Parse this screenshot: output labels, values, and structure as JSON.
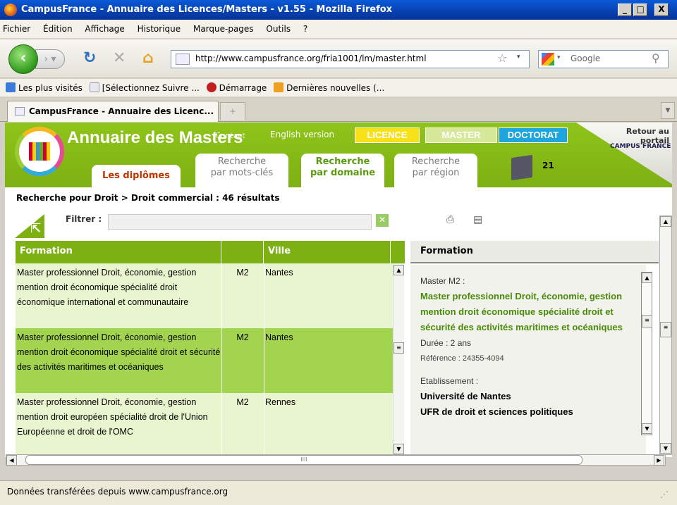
{
  "window": {
    "title": "CampusFrance - Annuaire des Licences/Masters - v1.55 - Mozilla Firefox",
    "minimize": "_",
    "maximize": "□",
    "close": "X"
  },
  "menu": [
    "Fichier",
    "Édition",
    "Affichage",
    "Historique",
    "Marque-pages",
    "Outils",
    "?"
  ],
  "nav": {
    "url": "http://www.campusfrance.org/fria1001/lm/master.html",
    "search_placeholder": "Google"
  },
  "bookmarks": [
    "Les plus visités",
    "[Sélectionnez Suivre ...",
    "Démarrage",
    "Dernières nouvelles (..."
  ],
  "tabs": {
    "active": "CampusFrance - Annuaire des Licenc...",
    "new": "+"
  },
  "site": {
    "title": "Annuaire des Masters",
    "contact": "Contact",
    "english": "English version",
    "levels": {
      "licence": "LICENCE",
      "master": "MASTER",
      "doctorat": "DOCTORAT"
    },
    "retour": "Retour au portail",
    "cf_logo": "CAMPUS FRANCE",
    "tab_diplomes": "Les diplômes",
    "tab_motscles_1": "Recherche",
    "tab_motscles_2": "par mots-clés",
    "tab_domaine_1": "Recherche",
    "tab_domaine_2": "par domaine",
    "tab_region_1": "Recherche",
    "tab_region_2": "par région",
    "selection_count": "21"
  },
  "breadcrumb": "Recherche pour Droit > Droit commercial : 46 résultats",
  "filter": {
    "label": "Filtrer :",
    "value": "",
    "clear": "✕"
  },
  "table": {
    "headers": {
      "formation": "Formation",
      "level": "",
      "ville": "Ville"
    },
    "rows": [
      {
        "formation": "Master professionnel Droit, économie, gestion mention droit économique spécialité droit économique international et communautaire",
        "level": "M2",
        "ville": "Nantes"
      },
      {
        "formation": "Master professionnel Droit, économie, gestion mention droit économique spécialité droit et sécurité des activités maritimes et océaniques",
        "level": "M2",
        "ville": "Nantes"
      },
      {
        "formation": "Master professionnel Droit, économie, gestion mention droit européen spécialité droit de l'Union Européenne et droit de l'OMC",
        "level": "M2",
        "ville": "Rennes"
      }
    ]
  },
  "detail": {
    "header": "Formation",
    "level_label": "Master M2 :",
    "title": "Master professionnel Droit, économie, gestion mention droit économique spécialité droit et sécurité des activités maritimes et océaniques",
    "duree": "Durée : 2 ans",
    "reference": "Référence : 24355-4094",
    "etab_label": "Etablissement :",
    "etab_name": "Université de Nantes",
    "etab_ufr": "UFR de droit et sciences politiques"
  },
  "status": "Données transférées depuis www.campusfrance.org",
  "colors": {
    "green": "#7db012",
    "row_selected": "#a3d450",
    "row": "#e9f5cf"
  }
}
